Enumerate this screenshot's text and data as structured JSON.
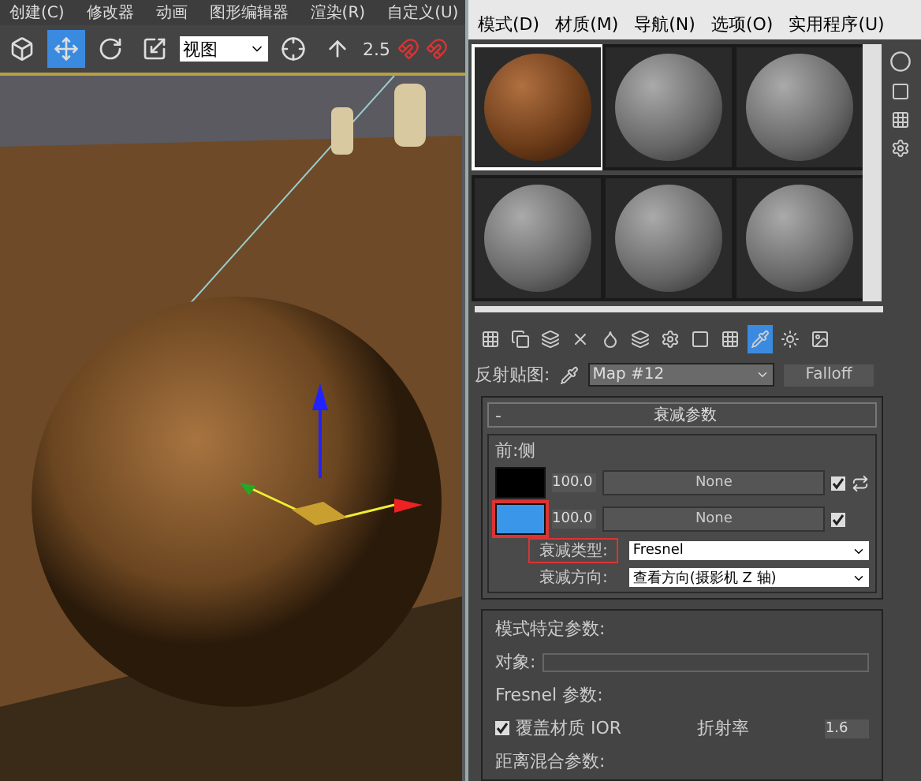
{
  "main_menu": [
    "创建(C)",
    "修改器",
    "动画",
    "图形编辑器",
    "渲染(R)",
    "自定义(U)"
  ],
  "main_toolbar": {
    "tools": [
      {
        "kind": "cube",
        "selected": false
      },
      {
        "kind": "move",
        "selected": true
      },
      {
        "kind": "rotate",
        "selected": false
      },
      {
        "kind": "scale",
        "selected": false
      }
    ],
    "view_dropdown": "视图",
    "snap_value": "2.5"
  },
  "material_editor": {
    "menu": [
      "模式(D)",
      "材质(M)",
      "导航(N)",
      "选项(O)",
      "实用程序(U)"
    ],
    "sample_slots": [
      {
        "kind": "wood",
        "selected": true
      },
      {
        "kind": "gray",
        "selected": false
      },
      {
        "kind": "gray",
        "selected": false
      },
      {
        "kind": "gray",
        "selected": false
      },
      {
        "kind": "gray",
        "selected": false
      },
      {
        "kind": "gray",
        "selected": false
      }
    ],
    "toolbar": [
      {
        "selected": false
      },
      {
        "selected": false
      },
      {
        "selected": false
      },
      {
        "selected": false
      },
      {
        "selected": false
      },
      {
        "selected": false
      },
      {
        "selected": false
      },
      {
        "selected": false
      },
      {
        "selected": false
      },
      {
        "selected": true
      },
      {
        "selected": false
      },
      {
        "selected": false
      }
    ],
    "map_label": "反射贴图:",
    "map_name": "Map #12",
    "map_type": "Falloff",
    "rollout": {
      "title": "衰减参数",
      "collapse": "-",
      "group": "前:侧",
      "colors": [
        {
          "color": "#000000",
          "amount": "100.0",
          "map": "None",
          "checked": true,
          "highlighted": false
        },
        {
          "color": "#3a96e8",
          "amount": "100.0",
          "map": "None",
          "checked": true,
          "highlighted": true
        }
      ],
      "falloff_type": {
        "label": "衰减类型:",
        "value": "Fresnel",
        "highlighted": true
      },
      "falloff_direction": {
        "label": "衰减方向:",
        "value": "查看方向(摄影机 Z 轴)"
      }
    },
    "mode_params": {
      "title": "模式特定参数:",
      "object_label": "对象:",
      "fresnel_title": "Fresnel 参数:",
      "override_ior": {
        "label": "覆盖材质 IOR",
        "checked": true
      },
      "ior_label": "折射率",
      "ior_value": "1.6",
      "distance_title": "距离混合参数:"
    }
  }
}
